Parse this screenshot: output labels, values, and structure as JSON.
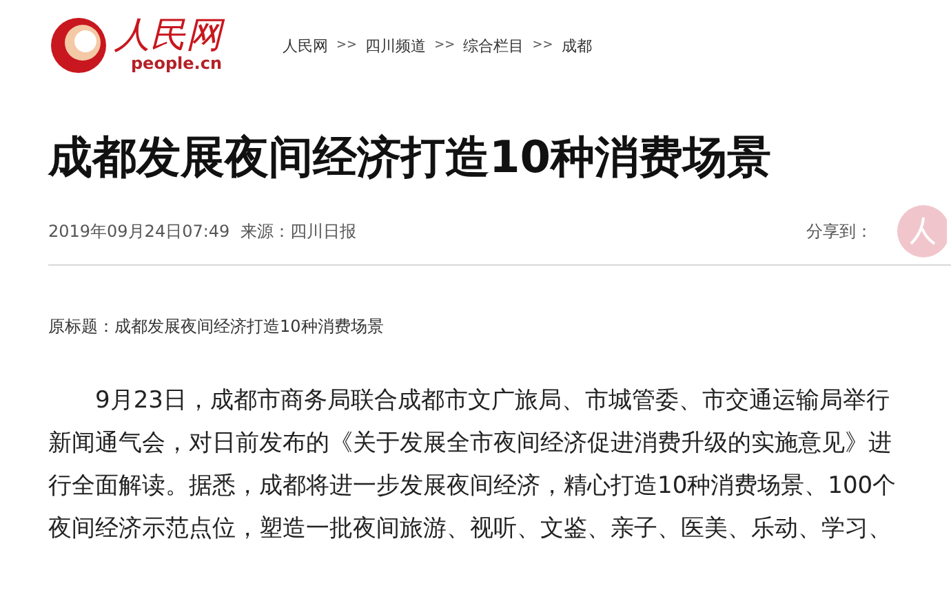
{
  "logo": {
    "name": "人民网",
    "domain": "people.cn"
  },
  "breadcrumb": {
    "separator": ">>",
    "items": [
      "人民网",
      "四川频道",
      "综合栏目",
      "成都"
    ]
  },
  "article": {
    "title": "成都发展夜间经济打造10种消费场景",
    "date": "2019年09月24日07:49",
    "source": "来源：四川日报",
    "share_label": "分享到：",
    "original_title": "原标题：成都发展夜间经济打造10种消费场景",
    "paragraph": "9月23日，成都市商务局联合成都市文广旅局、市城管委、市交通运输局举行新闻通气会，对日前发布的《关于发展全市夜间经济促进消费升级的实施意见》进行全面解读。据悉，成都将进一步发展夜间经济，精心打造10种消费场景、100个夜间经济示范点位，塑造一批夜间旅游、视听、文鉴、亲子、医美、乐动、学习、"
  }
}
